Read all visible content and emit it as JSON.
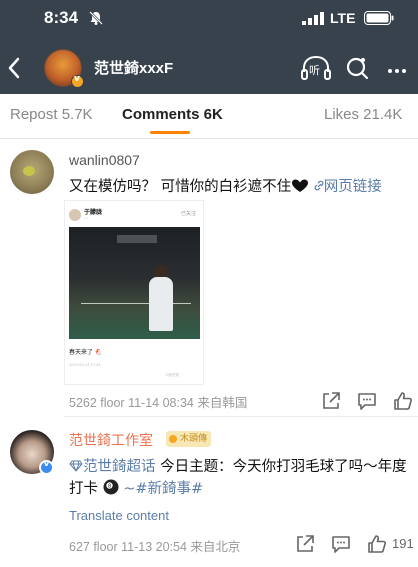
{
  "status_bar": {
    "time": "8:34",
    "network": "LTE"
  },
  "nav": {
    "title": "范世錡xxxF",
    "listen_label": "听"
  },
  "tabs": [
    {
      "label": "Repost 5.7K",
      "active": false
    },
    {
      "label": "Comments 6K",
      "active": true
    },
    {
      "label": "Likes 21.4K",
      "active": false
    }
  ],
  "comments": [
    {
      "username": "wanlin0807",
      "text": "又在模仿吗？ 可惜你的白衫遮不住",
      "link_label": "网页链接",
      "embed": {
        "name": "于朦胧",
        "subtitle": "...",
        "follow": "已关注",
        "caption": "春天来了 🐔",
        "footer": "2025-03-14 17:44",
        "footer2": "人脸识别"
      },
      "meta": "5262 floor 11-14 08:34 来自韩国"
    },
    {
      "username": "范世錡工作室",
      "fan_badge": "木頭傳",
      "topic": "范世錡超话",
      "text_main": " 今日主题：今天你打羽毛球了吗～年度",
      "text_line2_pre": "打卡",
      "text_line2_tag": "~#新錡事#",
      "translate": "Translate content",
      "meta": "627 floor 11-13 20:54 来自北京",
      "like_count": "191"
    }
  ],
  "colors": {
    "header_bg": "#37424d",
    "accent": "#ff8200",
    "link": "#5b7ea8",
    "orange_name": "#eb7350"
  }
}
